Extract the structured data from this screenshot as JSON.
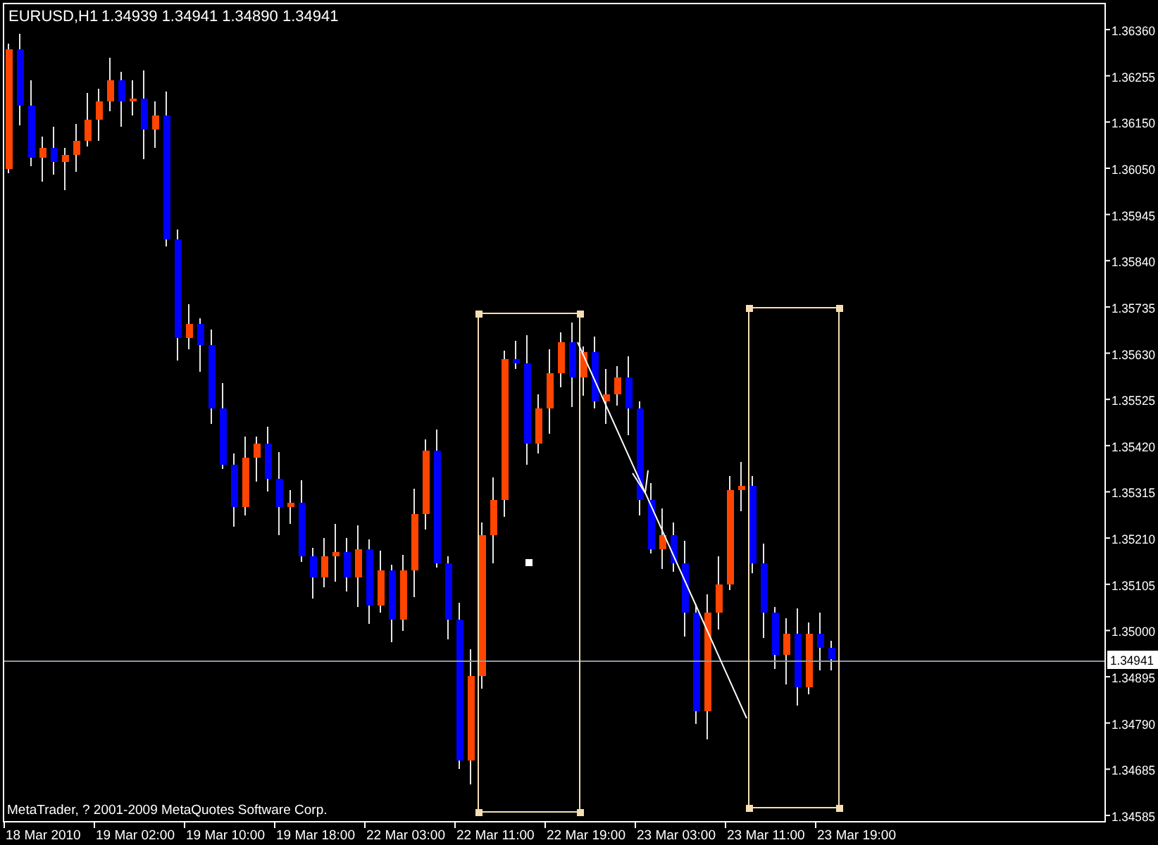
{
  "chart_header": {
    "symbol": "EURUSD,H1",
    "quotes": [
      "1.34939",
      "1.34941",
      "1.34890",
      "1.34941"
    ]
  },
  "price_axis": [
    "1.36360",
    "1.36255",
    "1.36150",
    "1.36050",
    "1.35945",
    "1.35840",
    "1.35735",
    "1.35630",
    "1.35525",
    "1.35420",
    "1.35315",
    "1.35210",
    "1.35105",
    "1.35000",
    "1.34895",
    "1.34790",
    "1.34685",
    "1.34585"
  ],
  "current_price": "1.34941",
  "time_axis": [
    "18 Mar 2010",
    "19 Mar 02:00",
    "19 Mar 10:00",
    "19 Mar 18:00",
    "22 Mar 03:00",
    "22 Mar 11:00",
    "22 Mar 19:00",
    "23 Mar 03:00",
    "23 Mar 11:00",
    "23 Mar 19:00"
  ],
  "copyright": "MetaTrader, ? 2001-2009 MetaQuotes Software Corp."
}
